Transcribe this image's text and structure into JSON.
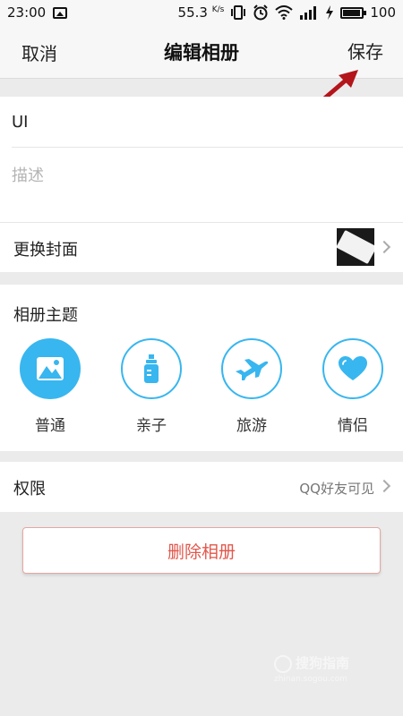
{
  "status_bar": {
    "time": "23:00",
    "net_speed": "55.3",
    "net_unit": "K/s",
    "battery": "100"
  },
  "nav": {
    "cancel": "取消",
    "title": "编辑相册",
    "save": "保存"
  },
  "album": {
    "name": "UI",
    "description_placeholder": "描述"
  },
  "cover": {
    "label": "更换封面"
  },
  "themes": {
    "label": "相册主题",
    "items": [
      {
        "name": "普通",
        "icon": "mountain-icon",
        "selected": true
      },
      {
        "name": "亲子",
        "icon": "baby-bottle-icon",
        "selected": false
      },
      {
        "name": "旅游",
        "icon": "airplane-icon",
        "selected": false
      },
      {
        "name": "情侣",
        "icon": "heart-icon",
        "selected": false
      }
    ]
  },
  "permission": {
    "label": "权限",
    "value": "QQ好友可见"
  },
  "delete_label": "删除相册",
  "watermark": {
    "text": "搜狗指南",
    "url": "zhinan.sogou.com"
  },
  "colors": {
    "accent": "#38b6ef",
    "danger": "#e2574b",
    "annotation_arrow": "#b3151b"
  }
}
